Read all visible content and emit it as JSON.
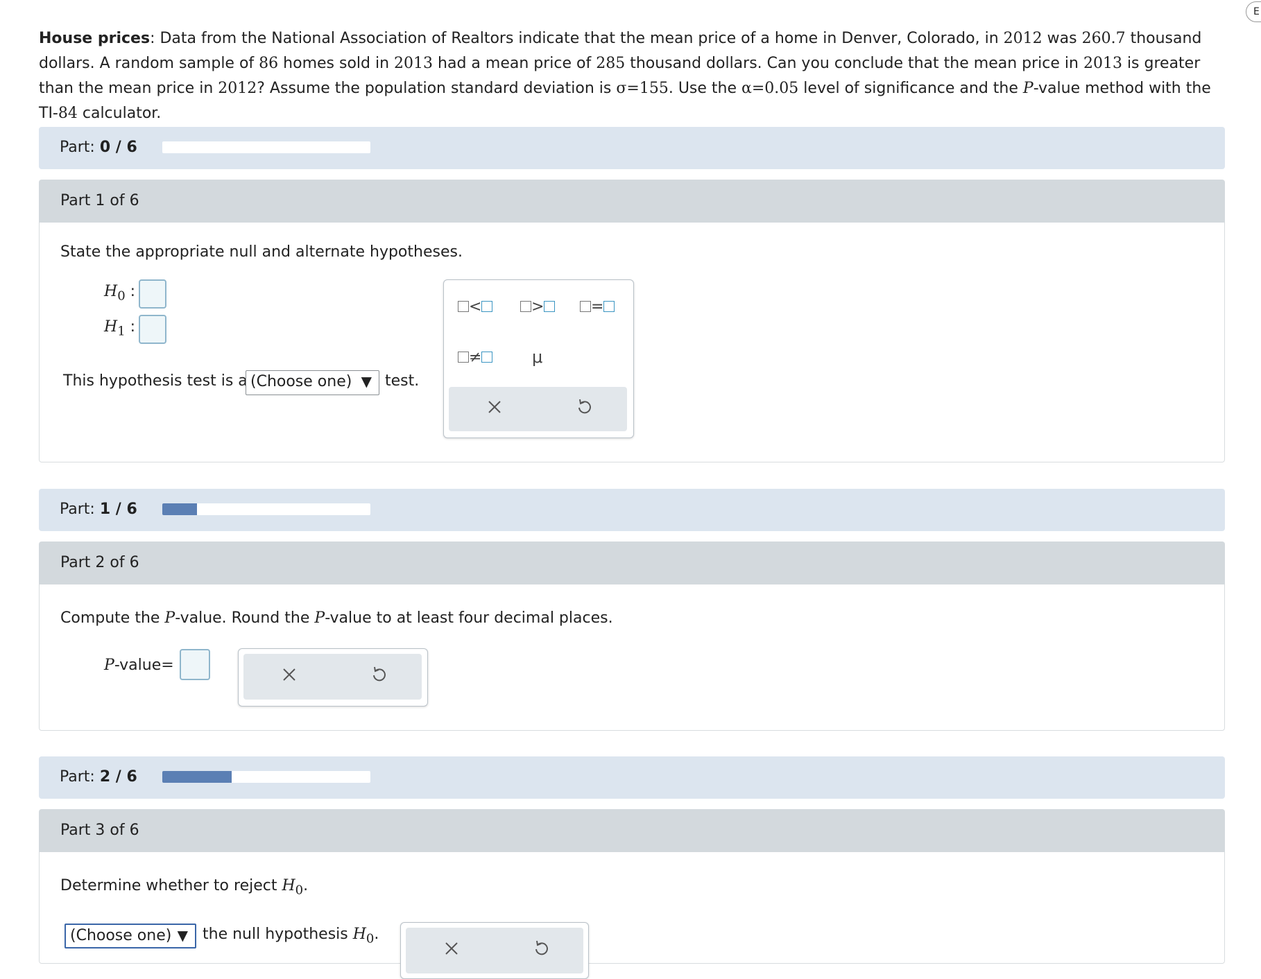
{
  "problem": {
    "title": "House prices",
    "text_1": ": Data from the National Association of Realtors indicate that the mean price of a home in Denver, Colorado, in ",
    "year_2012": "2012",
    "text_2": " was ",
    "mean_2012": "260.7",
    "text_3": " thousand dollars. A random sample of ",
    "sample_n": "86",
    "text_4": " homes sold in ",
    "year_2013": "2013",
    "text_5": " had a mean price of ",
    "mean_2013": "285",
    "text_6": " thousand dollars. Can you conclude that the mean price in ",
    "year_2013b": "2013",
    "text_7": " is greater than the mean price in ",
    "year_2012b": "2012",
    "text_8": "? Assume the population standard deviation is ",
    "sigma_expr": "σ=155",
    "text_9": ". Use the ",
    "alpha_expr": "α=0.05",
    "text_10": " level of significance and the ",
    "p_var": "P",
    "text_11": "-value method with the TI-",
    "ti_num": "84",
    "text_12": " calculator."
  },
  "progress": [
    {
      "label": "Part:",
      "value": "0 / 6",
      "fraction": 0.0
    },
    {
      "label": "Part:",
      "value": "1 / 6",
      "fraction": 0.1667
    },
    {
      "label": "Part:",
      "value": "2 / 6",
      "fraction": 0.3333
    }
  ],
  "part1": {
    "header": "Part 1 of 6",
    "prompt": "State the appropriate null and alternate hypotheses.",
    "h0_label": "H",
    "h0_sub": "0",
    "h1_label": "H",
    "h1_sub": "1",
    "test_prefix": "This hypothesis test is a",
    "test_select": "(Choose one)",
    "test_suffix": "test.",
    "palette": {
      "less_than": "<",
      "greater_than": ">",
      "equals": "=",
      "not_equal": "≠",
      "mu": "μ",
      "clear_icon": "close-icon",
      "undo_icon": "undo-icon"
    }
  },
  "part2": {
    "header": "Part 2 of 6",
    "prompt_1": "Compute the ",
    "p_var": "P",
    "prompt_2": "-value. Round the ",
    "prompt_3": "-value to at least four decimal places.",
    "answer_label_var": "P",
    "answer_label_text": "-value",
    "equals": "="
  },
  "part3": {
    "header": "Part 3 of 6",
    "prompt": "Determine whether to reject ",
    "h_var": "H",
    "h_sub": "0",
    "prompt_end": ".",
    "select": "(Choose one)",
    "after_select": "the null hypothesis ",
    "after_end": "."
  },
  "edge_button_text": "E",
  "colors": {
    "progress_fill": "#5b7fb4",
    "progress_bg": "#dce5ef",
    "part_header": "#d3d9dd",
    "answer_border": "#8fb6cc"
  }
}
